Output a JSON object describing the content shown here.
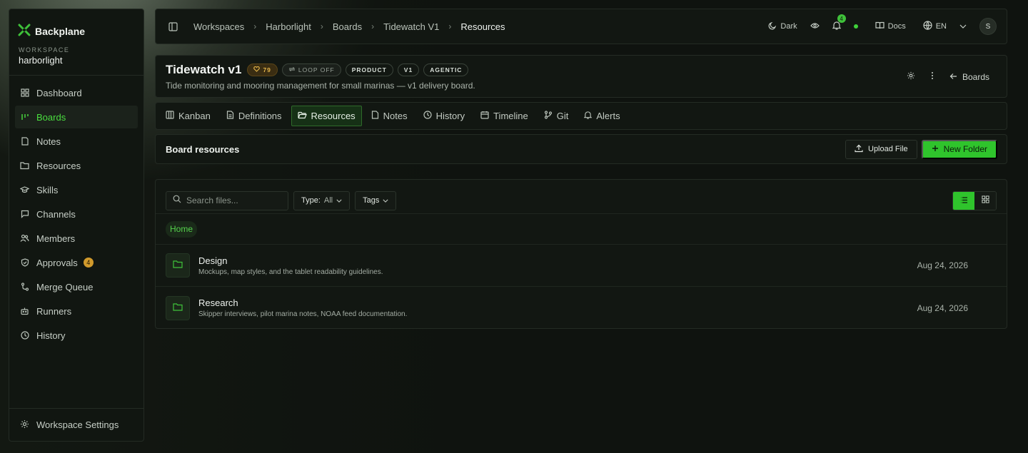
{
  "brand": {
    "name": "Backplane",
    "accent": "#3fc13a"
  },
  "workspace": {
    "label": "WORKSPACE",
    "name": "harborlight"
  },
  "sidebar": {
    "items": [
      {
        "label": "Dashboard",
        "icon": "grid-icon"
      },
      {
        "label": "Boards",
        "icon": "boards-icon",
        "active": true
      },
      {
        "label": "Notes",
        "icon": "note-icon"
      },
      {
        "label": "Resources",
        "icon": "folder-icon"
      },
      {
        "label": "Skills",
        "icon": "graduation-cap-icon"
      },
      {
        "label": "Channels",
        "icon": "chat-icon"
      },
      {
        "label": "Members",
        "icon": "users-icon"
      },
      {
        "label": "Approvals",
        "icon": "shield-icon",
        "badge": "4"
      },
      {
        "label": "Merge Queue",
        "icon": "git-merge-icon"
      },
      {
        "label": "Runners",
        "icon": "bot-icon"
      },
      {
        "label": "History",
        "icon": "clock-icon"
      }
    ],
    "footer": "Workspace Settings"
  },
  "topbar": {
    "crumbs": [
      "Workspaces",
      "Harborlight",
      "Boards",
      "Tidewatch V1",
      "Resources"
    ],
    "theme_label": "Dark",
    "notifications": "4",
    "docs_label": "Docs",
    "lang_label": "EN",
    "avatar_initial": "S"
  },
  "board": {
    "title": "Tidewatch v1",
    "score": "79",
    "loop": "LOOP OFF",
    "tags": [
      "PRODUCT",
      "V1",
      "AGENTIC"
    ],
    "description": "Tide monitoring and mooring management for small marinas — v1 delivery board.",
    "back_label": "Boards"
  },
  "tabs": [
    {
      "label": "Kanban",
      "icon": "columns-icon"
    },
    {
      "label": "Definitions",
      "icon": "document-icon"
    },
    {
      "label": "Resources",
      "icon": "folder-open-icon",
      "active": true
    },
    {
      "label": "Notes",
      "icon": "note-icon"
    },
    {
      "label": "History",
      "icon": "clock-icon"
    },
    {
      "label": "Timeline",
      "icon": "calendar-icon"
    },
    {
      "label": "Git",
      "icon": "git-branch-icon"
    },
    {
      "label": "Alerts",
      "icon": "bell-icon"
    }
  ],
  "resources": {
    "title": "Board resources",
    "upload_label": "Upload File",
    "new_folder_label": "New Folder",
    "search_placeholder": "Search files...",
    "type_label": "Type:",
    "type_value": "All",
    "tags_label": "Tags",
    "path_home": "Home",
    "files": [
      {
        "name": "Design",
        "description": "Mockups, map styles, and the tablet readability guidelines.",
        "date": "Aug 24, 2026"
      },
      {
        "name": "Research",
        "description": "Skipper interviews, pilot marina notes, NOAA feed documentation.",
        "date": "Aug 24, 2026"
      }
    ]
  }
}
